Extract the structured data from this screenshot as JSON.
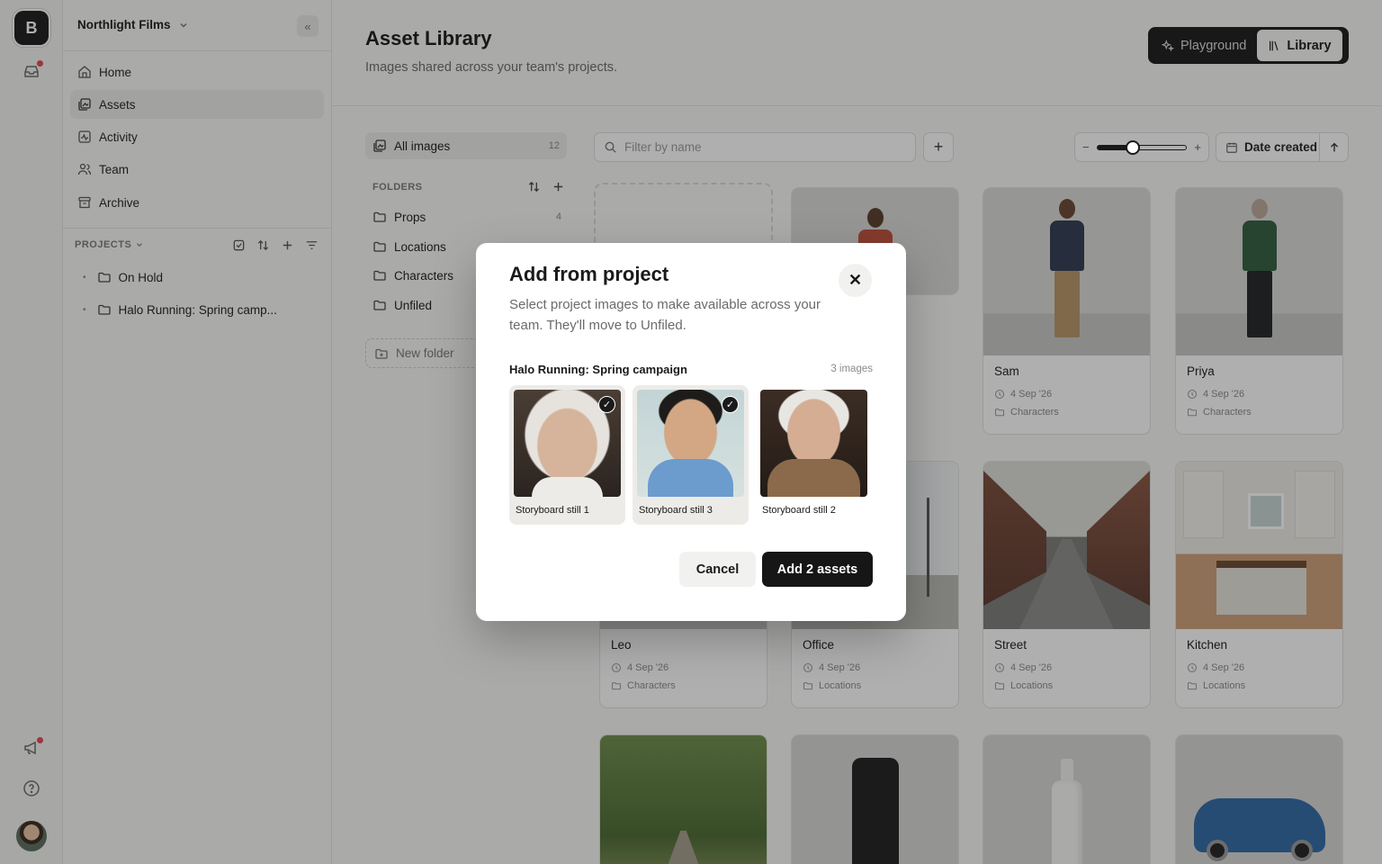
{
  "rail": {
    "logo_letter": "B",
    "icons": [
      "inbox-icon",
      "megaphone-icon",
      "help-icon"
    ],
    "notification_color": "#e5484d"
  },
  "sidebar": {
    "org_name": "Northlight Films",
    "nav": [
      {
        "label": "Home",
        "icon": "home-icon"
      },
      {
        "label": "Assets",
        "icon": "assets-icon",
        "active": true
      },
      {
        "label": "Activity",
        "icon": "activity-icon"
      },
      {
        "label": "Team",
        "icon": "team-icon"
      },
      {
        "label": "Archive",
        "icon": "archive-icon"
      }
    ],
    "projects_header": "PROJECTS",
    "projects": [
      {
        "label": "On Hold"
      },
      {
        "label": "Halo Running: Spring camp..."
      }
    ]
  },
  "header": {
    "title": "Asset Library",
    "subtitle": "Images shared across your team's projects.",
    "toggle": {
      "playground": "Playground",
      "library": "Library",
      "selected": "Library"
    }
  },
  "library": {
    "all_images_label": "All images",
    "all_images_count": "12",
    "folders_header": "FOLDERS",
    "folders": [
      {
        "label": "Props",
        "count": "4"
      },
      {
        "label": "Locations",
        "count": ""
      },
      {
        "label": "Characters",
        "count": ""
      },
      {
        "label": "Unfiled",
        "count": ""
      }
    ],
    "new_folder_label": "New folder",
    "search_placeholder": "Filter by name",
    "zoom_level": 0.4,
    "sort_label": "Date created",
    "sort_direction": "ascending"
  },
  "cards": [
    {
      "name": "Sam",
      "date": "4 Sep '26",
      "folder": "Characters"
    },
    {
      "name": "Priya",
      "date": "4 Sep '26",
      "folder": "Characters"
    },
    {
      "name": "Leo",
      "date": "4 Sep '26",
      "folder": "Characters"
    },
    {
      "name": "Office",
      "date": "4 Sep '26",
      "folder": "Locations"
    },
    {
      "name": "Street",
      "date": "4 Sep '26",
      "folder": "Locations"
    },
    {
      "name": "Kitchen",
      "date": "4 Sep '26",
      "folder": "Locations"
    }
  ],
  "modal": {
    "title": "Add from project",
    "description": "Select project images to make available across your team. They'll move to Unfiled.",
    "group_name": "Halo Running: Spring campaign",
    "group_count": "3 images",
    "images": [
      {
        "caption": "Storyboard still 1",
        "selected": true
      },
      {
        "caption": "Storyboard still 3",
        "selected": true
      },
      {
        "caption": "Storyboard still 2",
        "selected": false
      }
    ],
    "cancel_label": "Cancel",
    "confirm_label": "Add 2 assets"
  }
}
